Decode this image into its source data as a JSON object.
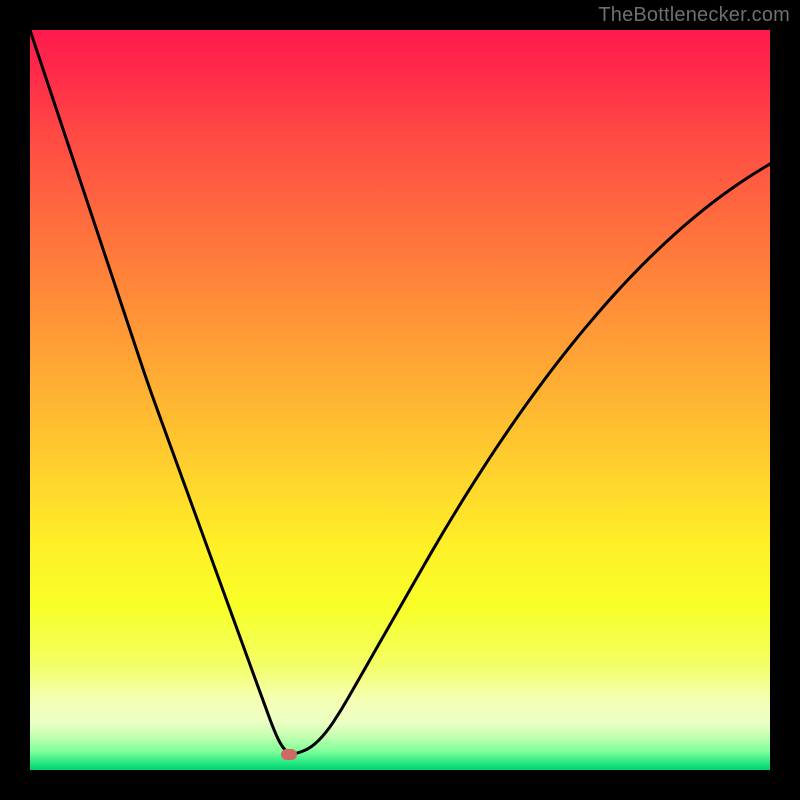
{
  "watermark": {
    "text": "TheBottlenecker.com"
  },
  "chart_data": {
    "type": "line",
    "title": "",
    "xlabel": "",
    "ylabel": "",
    "xlim": [
      0,
      100
    ],
    "ylim": [
      0,
      100
    ],
    "x": [
      0,
      2,
      4,
      6,
      8,
      10,
      12,
      14,
      16,
      18,
      20,
      22,
      24,
      26,
      28,
      30,
      32,
      33,
      34,
      35,
      36,
      38,
      40,
      42,
      44,
      46,
      48,
      50,
      52,
      54,
      56,
      58,
      60,
      62,
      64,
      66,
      68,
      70,
      72,
      74,
      76,
      78,
      80,
      82,
      84,
      86,
      88,
      90,
      92,
      94,
      96,
      98,
      100
    ],
    "values": [
      100,
      94,
      88,
      82,
      76,
      70,
      64,
      58,
      52,
      46.5,
      41,
      35.5,
      30,
      24.5,
      19,
      13.5,
      8,
      5.3,
      3.2,
      2.2,
      2.2,
      3,
      5,
      8,
      11.5,
      15,
      18.5,
      22,
      25.5,
      29,
      32.4,
      35.7,
      38.9,
      42,
      45,
      47.9,
      50.7,
      53.4,
      56,
      58.5,
      60.9,
      63.2,
      65.4,
      67.5,
      69.5,
      71.4,
      73.2,
      74.9,
      76.5,
      78,
      79.4,
      80.7,
      81.9
    ],
    "marker": {
      "x": 35,
      "y": 2.2,
      "color": "#cf6a63"
    },
    "gradient_stops": [
      {
        "offset": 0.0,
        "color": "#ff1a4d"
      },
      {
        "offset": 0.06,
        "color": "#ff2b4a"
      },
      {
        "offset": 0.14,
        "color": "#ff4944"
      },
      {
        "offset": 0.22,
        "color": "#ff6140"
      },
      {
        "offset": 0.3,
        "color": "#ff793c"
      },
      {
        "offset": 0.38,
        "color": "#ff9138"
      },
      {
        "offset": 0.46,
        "color": "#ffa934"
      },
      {
        "offset": 0.54,
        "color": "#ffc130"
      },
      {
        "offset": 0.62,
        "color": "#ffd92c"
      },
      {
        "offset": 0.7,
        "color": "#fff028"
      },
      {
        "offset": 0.78,
        "color": "#f8ff28"
      },
      {
        "offset": 0.855,
        "color": "#f3ff62"
      },
      {
        "offset": 0.905,
        "color": "#f4ffb4"
      },
      {
        "offset": 0.935,
        "color": "#edffc4"
      },
      {
        "offset": 0.955,
        "color": "#c3ffb0"
      },
      {
        "offset": 0.975,
        "color": "#7eff9a"
      },
      {
        "offset": 0.992,
        "color": "#20e47e"
      },
      {
        "offset": 1.0,
        "color": "#00d276"
      }
    ]
  }
}
